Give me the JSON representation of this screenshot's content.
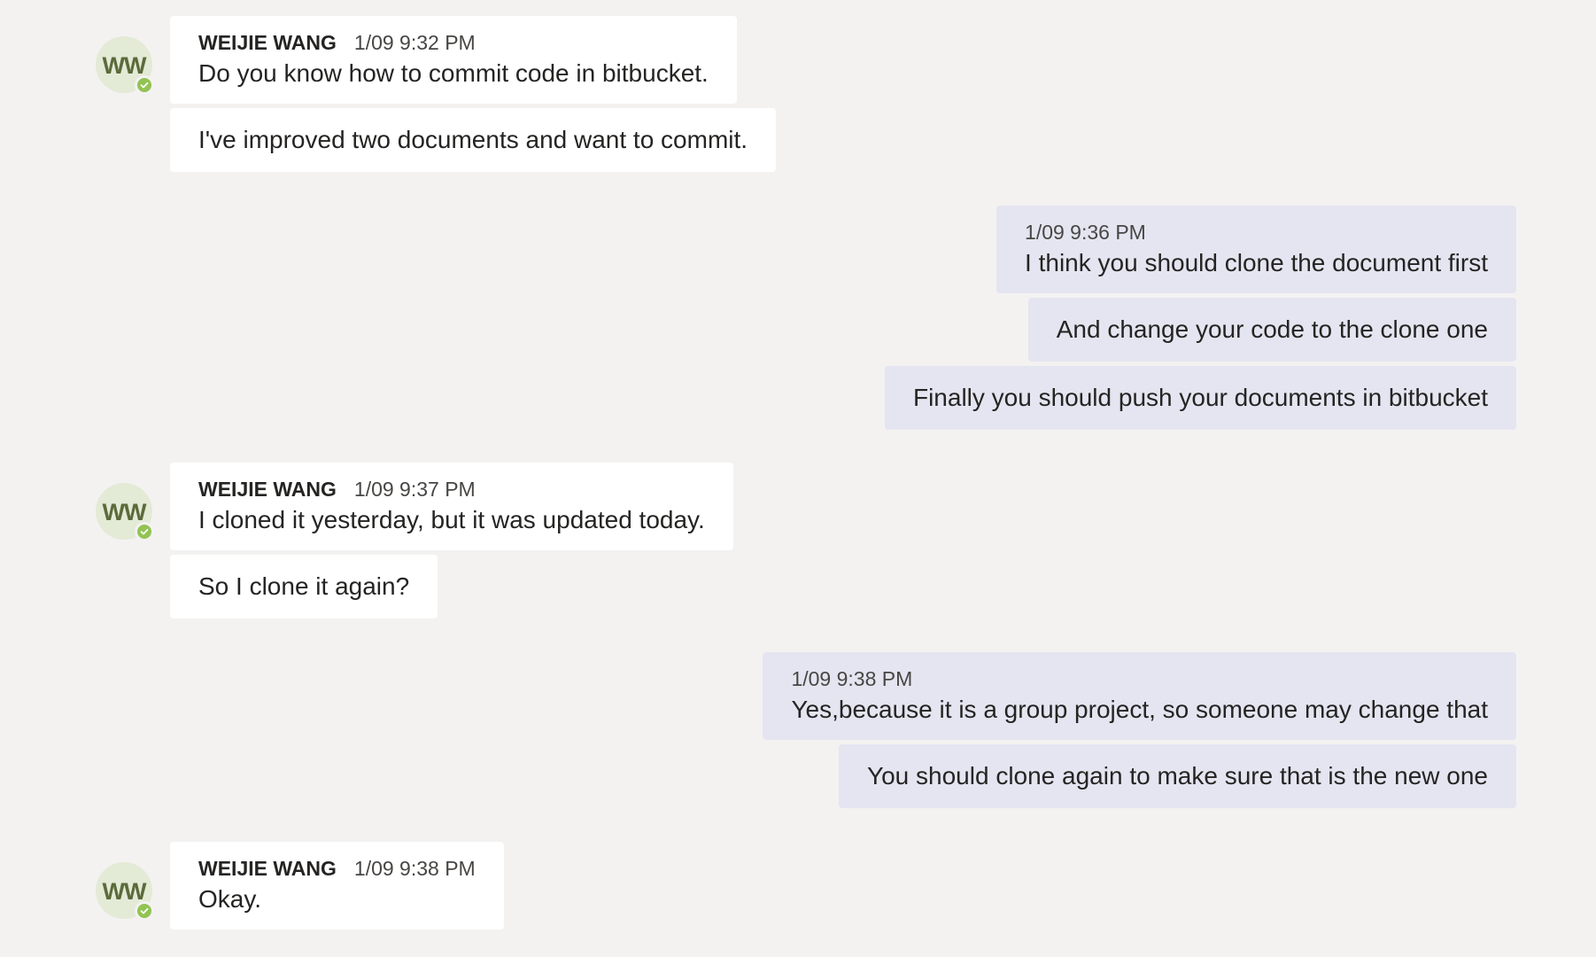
{
  "chat": {
    "groups": [
      {
        "direction": "incoming",
        "avatar_initials": "WW",
        "sender": "WEIJIE WANG",
        "time": "1/09 9:32 PM",
        "messages": [
          "Do you know how to commit code in bitbucket.",
          "I've improved two documents and want to commit."
        ]
      },
      {
        "direction": "outgoing",
        "time": "1/09 9:36 PM",
        "messages": [
          "I think you should clone the document first",
          "And change your code to the clone one",
          "Finally you should push your documents in bitbucket"
        ]
      },
      {
        "direction": "incoming",
        "avatar_initials": "WW",
        "sender": "WEIJIE WANG",
        "time": "1/09 9:37 PM",
        "messages": [
          "I cloned it yesterday, but it was updated today.",
          "So I clone it again?"
        ]
      },
      {
        "direction": "outgoing",
        "time": "1/09 9:38 PM",
        "messages": [
          "Yes,because it is a group project, so someone may change that",
          "You should clone again to make sure that is the new one"
        ]
      },
      {
        "direction": "incoming",
        "avatar_initials": "WW",
        "sender": "WEIJIE WANG",
        "time": "1/09 9:38 PM",
        "messages": [
          "Okay."
        ]
      }
    ]
  },
  "colors": {
    "background": "#f3f2f1",
    "incoming_bubble": "#ffffff",
    "outgoing_bubble": "#e5e5f1",
    "avatar_bg": "#e3ead6",
    "presence_available": "#92c353"
  },
  "icons": {
    "presence": "available-check-icon"
  }
}
